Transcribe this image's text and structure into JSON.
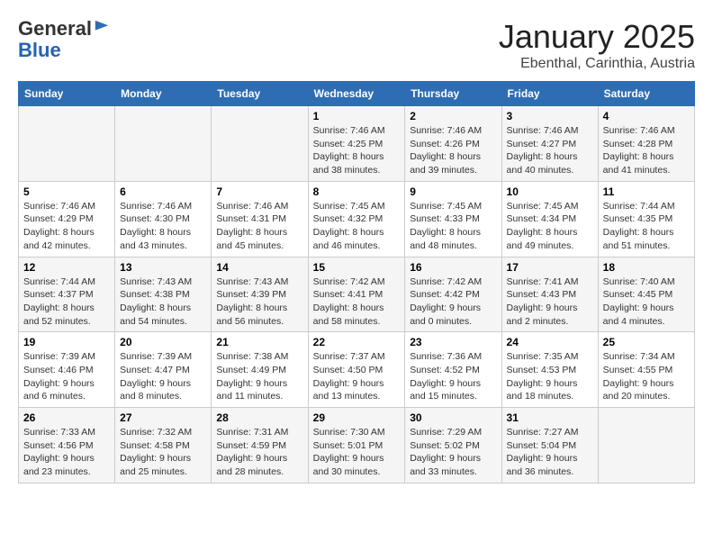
{
  "header": {
    "logo_general": "General",
    "logo_blue": "Blue",
    "month_title": "January 2025",
    "location": "Ebenthal, Carinthia, Austria"
  },
  "weekdays": [
    "Sunday",
    "Monday",
    "Tuesday",
    "Wednesday",
    "Thursday",
    "Friday",
    "Saturday"
  ],
  "weeks": [
    [
      {
        "day": "",
        "info": ""
      },
      {
        "day": "",
        "info": ""
      },
      {
        "day": "",
        "info": ""
      },
      {
        "day": "1",
        "info": "Sunrise: 7:46 AM\nSunset: 4:25 PM\nDaylight: 8 hours\nand 38 minutes."
      },
      {
        "day": "2",
        "info": "Sunrise: 7:46 AM\nSunset: 4:26 PM\nDaylight: 8 hours\nand 39 minutes."
      },
      {
        "day": "3",
        "info": "Sunrise: 7:46 AM\nSunset: 4:27 PM\nDaylight: 8 hours\nand 40 minutes."
      },
      {
        "day": "4",
        "info": "Sunrise: 7:46 AM\nSunset: 4:28 PM\nDaylight: 8 hours\nand 41 minutes."
      }
    ],
    [
      {
        "day": "5",
        "info": "Sunrise: 7:46 AM\nSunset: 4:29 PM\nDaylight: 8 hours\nand 42 minutes."
      },
      {
        "day": "6",
        "info": "Sunrise: 7:46 AM\nSunset: 4:30 PM\nDaylight: 8 hours\nand 43 minutes."
      },
      {
        "day": "7",
        "info": "Sunrise: 7:46 AM\nSunset: 4:31 PM\nDaylight: 8 hours\nand 45 minutes."
      },
      {
        "day": "8",
        "info": "Sunrise: 7:45 AM\nSunset: 4:32 PM\nDaylight: 8 hours\nand 46 minutes."
      },
      {
        "day": "9",
        "info": "Sunrise: 7:45 AM\nSunset: 4:33 PM\nDaylight: 8 hours\nand 48 minutes."
      },
      {
        "day": "10",
        "info": "Sunrise: 7:45 AM\nSunset: 4:34 PM\nDaylight: 8 hours\nand 49 minutes."
      },
      {
        "day": "11",
        "info": "Sunrise: 7:44 AM\nSunset: 4:35 PM\nDaylight: 8 hours\nand 51 minutes."
      }
    ],
    [
      {
        "day": "12",
        "info": "Sunrise: 7:44 AM\nSunset: 4:37 PM\nDaylight: 8 hours\nand 52 minutes."
      },
      {
        "day": "13",
        "info": "Sunrise: 7:43 AM\nSunset: 4:38 PM\nDaylight: 8 hours\nand 54 minutes."
      },
      {
        "day": "14",
        "info": "Sunrise: 7:43 AM\nSunset: 4:39 PM\nDaylight: 8 hours\nand 56 minutes."
      },
      {
        "day": "15",
        "info": "Sunrise: 7:42 AM\nSunset: 4:41 PM\nDaylight: 8 hours\nand 58 minutes."
      },
      {
        "day": "16",
        "info": "Sunrise: 7:42 AM\nSunset: 4:42 PM\nDaylight: 9 hours\nand 0 minutes."
      },
      {
        "day": "17",
        "info": "Sunrise: 7:41 AM\nSunset: 4:43 PM\nDaylight: 9 hours\nand 2 minutes."
      },
      {
        "day": "18",
        "info": "Sunrise: 7:40 AM\nSunset: 4:45 PM\nDaylight: 9 hours\nand 4 minutes."
      }
    ],
    [
      {
        "day": "19",
        "info": "Sunrise: 7:39 AM\nSunset: 4:46 PM\nDaylight: 9 hours\nand 6 minutes."
      },
      {
        "day": "20",
        "info": "Sunrise: 7:39 AM\nSunset: 4:47 PM\nDaylight: 9 hours\nand 8 minutes."
      },
      {
        "day": "21",
        "info": "Sunrise: 7:38 AM\nSunset: 4:49 PM\nDaylight: 9 hours\nand 11 minutes."
      },
      {
        "day": "22",
        "info": "Sunrise: 7:37 AM\nSunset: 4:50 PM\nDaylight: 9 hours\nand 13 minutes."
      },
      {
        "day": "23",
        "info": "Sunrise: 7:36 AM\nSunset: 4:52 PM\nDaylight: 9 hours\nand 15 minutes."
      },
      {
        "day": "24",
        "info": "Sunrise: 7:35 AM\nSunset: 4:53 PM\nDaylight: 9 hours\nand 18 minutes."
      },
      {
        "day": "25",
        "info": "Sunrise: 7:34 AM\nSunset: 4:55 PM\nDaylight: 9 hours\nand 20 minutes."
      }
    ],
    [
      {
        "day": "26",
        "info": "Sunrise: 7:33 AM\nSunset: 4:56 PM\nDaylight: 9 hours\nand 23 minutes."
      },
      {
        "day": "27",
        "info": "Sunrise: 7:32 AM\nSunset: 4:58 PM\nDaylight: 9 hours\nand 25 minutes."
      },
      {
        "day": "28",
        "info": "Sunrise: 7:31 AM\nSunset: 4:59 PM\nDaylight: 9 hours\nand 28 minutes."
      },
      {
        "day": "29",
        "info": "Sunrise: 7:30 AM\nSunset: 5:01 PM\nDaylight: 9 hours\nand 30 minutes."
      },
      {
        "day": "30",
        "info": "Sunrise: 7:29 AM\nSunset: 5:02 PM\nDaylight: 9 hours\nand 33 minutes."
      },
      {
        "day": "31",
        "info": "Sunrise: 7:27 AM\nSunset: 5:04 PM\nDaylight: 9 hours\nand 36 minutes."
      },
      {
        "day": "",
        "info": ""
      }
    ]
  ]
}
